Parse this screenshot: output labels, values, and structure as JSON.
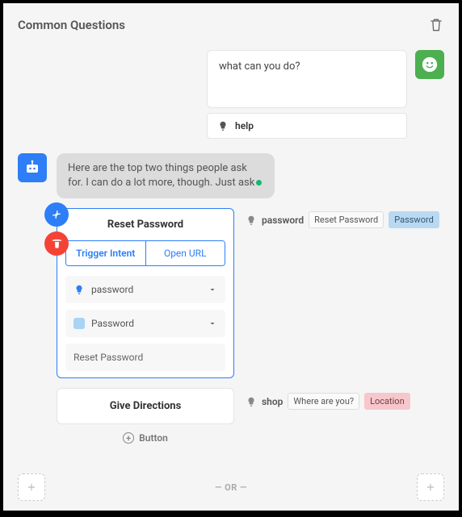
{
  "header": {
    "title": "Common Questions"
  },
  "user": {
    "text": "what can you do?"
  },
  "help": {
    "label": "help"
  },
  "bot": {
    "text": "Here are the top two things people ask for. I can do a lot more, though. Just ask"
  },
  "card": {
    "title": "Reset Password",
    "segTrigger": "Trigger Intent",
    "segUrl": "Open URL",
    "intentField": "password",
    "entityField": "Password",
    "valueField": "Reset Password"
  },
  "side1": {
    "label": "password",
    "tag1": "Reset Password",
    "tag2": "Password"
  },
  "card2": {
    "title": "Give Directions"
  },
  "side2": {
    "label": "shop",
    "tag1": "Where are you?",
    "tag2": "Location"
  },
  "addButton": {
    "label": "Button"
  },
  "footer": {
    "or": "— OR —"
  }
}
